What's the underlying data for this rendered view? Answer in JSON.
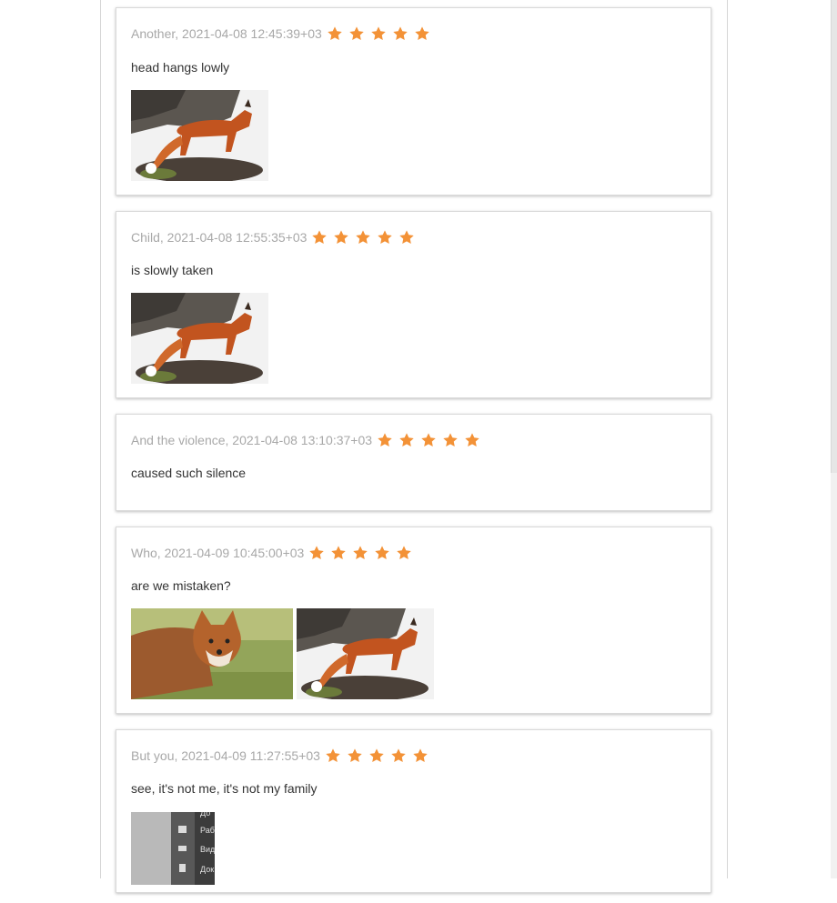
{
  "colors": {
    "star": "#f39237",
    "meta": "#a8a8a8",
    "text": "#333333"
  },
  "reviews": [
    {
      "meta": "Another, 2021-04-08 12:45:39+03",
      "rating": 5,
      "text": "head hangs lowly",
      "images": [
        "fox-in-snow-photo"
      ]
    },
    {
      "meta": "Child, 2021-04-08 12:55:35+03",
      "rating": 5,
      "text": "is slowly taken",
      "images": [
        "fox-in-snow-photo"
      ]
    },
    {
      "meta": "And the violence, 2021-04-08 13:10:37+03",
      "rating": 5,
      "text": "caused such silence",
      "images": []
    },
    {
      "meta": "Who, 2021-04-09 10:45:00+03",
      "rating": 5,
      "text": "are we mistaken?",
      "images": [
        "fox-on-grass-photo",
        "fox-in-snow-photo"
      ]
    },
    {
      "meta": "But you, 2021-04-09 11:27:55+03",
      "rating": 5,
      "text": "see, it's not me, it's not my family",
      "images": [
        "file-menu-screenshot"
      ]
    }
  ],
  "screenshot_menu": {
    "items": [
      "До",
      "Раб",
      "Вид",
      "Док"
    ]
  }
}
